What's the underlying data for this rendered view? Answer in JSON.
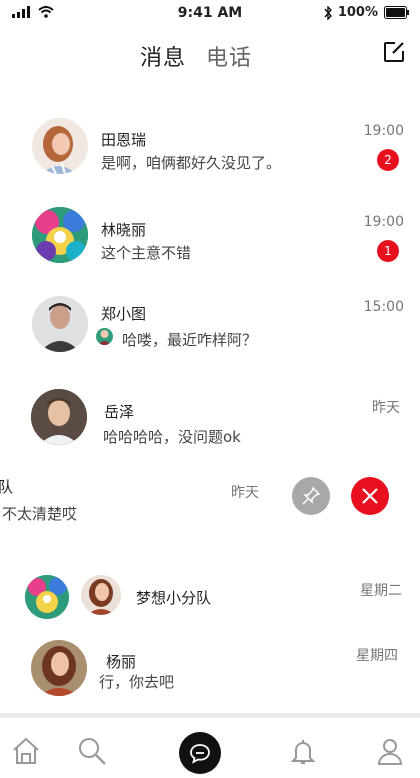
{
  "status_bar": {
    "time": "9:41 AM",
    "battery": "100%"
  },
  "header": {
    "tabs": [
      "消息",
      "电话"
    ]
  },
  "conversations": [
    {
      "name": "田恩瑞",
      "message": "是啊，咱俩都好久没见了。",
      "time": "19:00",
      "badge": "2"
    },
    {
      "name": "林晓丽",
      "message": "这个主意不错",
      "time": "19:00",
      "badge": "1"
    },
    {
      "name": "郑小图",
      "message": "哈喽，最近咋样阿？",
      "time": "15:00"
    },
    {
      "name": "岳泽",
      "message": "哈哈哈哈，没问题ok",
      "time": "昨天"
    },
    {
      "name": "队",
      "message": "不太清楚哎",
      "time": "昨天"
    },
    {
      "name": "梦想小分队",
      "message": "",
      "time": "星期二"
    },
    {
      "name": "杨丽",
      "message": "行，你去吧",
      "time": "星期四"
    }
  ],
  "colors": {
    "badge": "#e8101e",
    "delete": "#e8101e",
    "pin": "#a8a8a8",
    "chat_tab": "#111111"
  },
  "icons": [
    "home-icon",
    "search-icon",
    "chat-icon",
    "bell-icon",
    "profile-icon",
    "compose-icon",
    "pin-icon",
    "close-icon"
  ]
}
